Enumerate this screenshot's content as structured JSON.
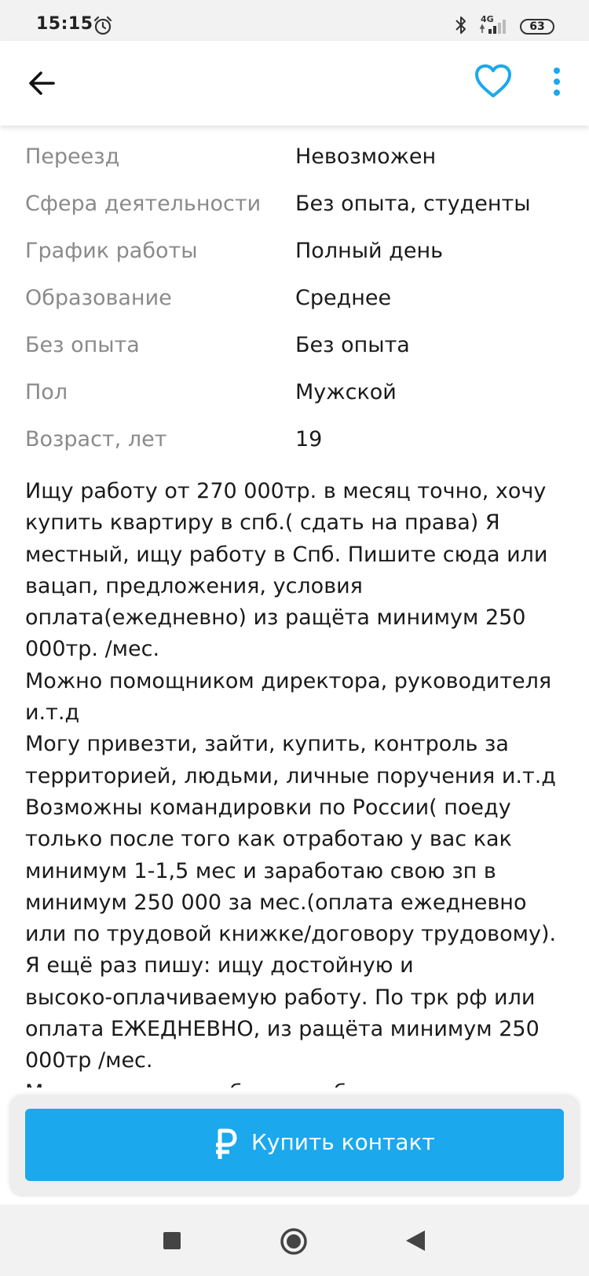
{
  "status_bar": {
    "time": "15:15",
    "network": "4G",
    "battery": "63"
  },
  "app_bar": {
    "icons": [
      "arrow-back-icon",
      "heart-outline-icon",
      "more-vertical-icon"
    ],
    "accent_color": "#1ba8ec"
  },
  "attributes": [
    {
      "label": "Переезд",
      "value": "Невозможен"
    },
    {
      "label": "Сфера деятельности",
      "value": "Без опыта, студенты"
    },
    {
      "label": "График работы",
      "value": "Полный день"
    },
    {
      "label": "Образование",
      "value": "Среднее"
    },
    {
      "label": "Без опыта",
      "value": "Без опыта"
    },
    {
      "label": "Пол",
      "value": "Мужской"
    },
    {
      "label": "Возраст, лет",
      "value": "19"
    }
  ],
  "description_lines": [
    "Ищу работу от 270 000тр. в месяц точно, хочу",
    "купить квартиру в спб.( сдать на права) Я",
    "местный, ищу работу в Спб. Пишите сюда или",
    "вацап, предложения, условия",
    "оплата(ежедневно) из ращёта минимум 250",
    "000тр. /мес.",
    "Можно помощником директора, руководителя",
    "и.т.д",
    "Могу привезти, зайти, купить, контроль за",
    "территорией, людьми, личные поручения и.т.д",
    "Возможны командировки по России( поеду",
    "только после того как отработаю  у вас как",
    "минимум  1-1,5 мес и заработаю свою зп в",
    "минимум  250 000 за мес.(оплата ежедневно",
    "или по трудовой книжке/договору трудовому).",
    "Я ещё раз пишу: ищу достойную и",
    "высоко-оплачиваемую работу. По трк рф или",
    "оплата ЕЖЕДНЕВНО, из ращёта минимум 250",
    "000тр /мес.",
    "Можно как: подработка, работа, научите меня и"
  ],
  "cta": {
    "label": "Купить контакт",
    "icon": "ruble-icon",
    "color": "#1ba8ec"
  },
  "nav_bar": {
    "icons": [
      "nav-recents-icon",
      "nav-home-icon",
      "nav-back-icon"
    ]
  }
}
